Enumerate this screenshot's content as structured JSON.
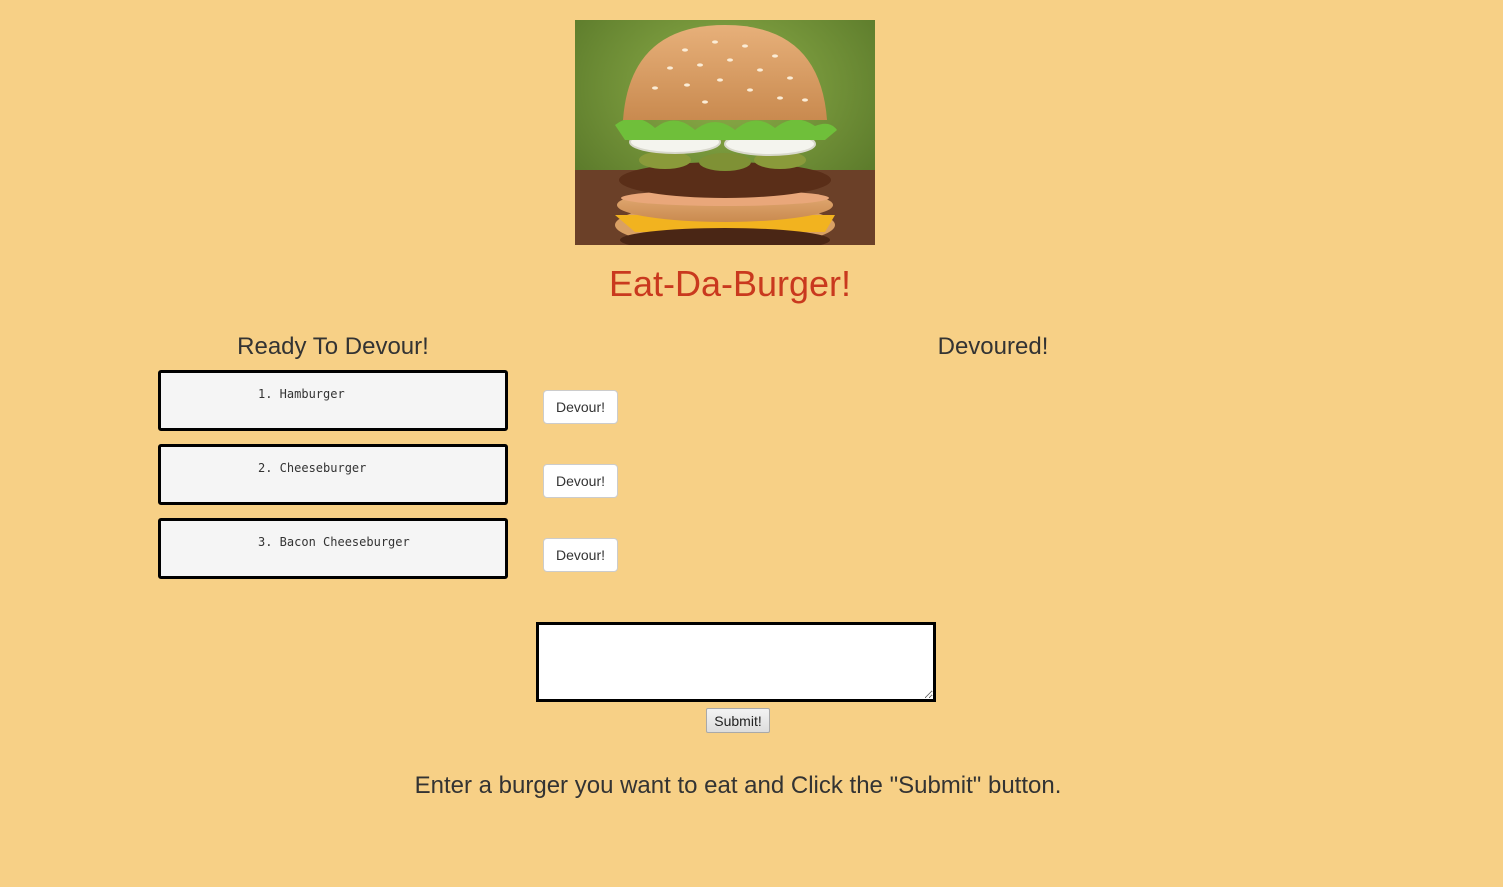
{
  "hero": {
    "image": "burger-photo"
  },
  "title": "Eat-Da-Burger!",
  "ready": {
    "heading": "Ready To Devour!",
    "burgers": [
      {
        "label": "1. Hamburger",
        "button": "Devour!"
      },
      {
        "label": "2. Cheeseburger",
        "button": "Devour!"
      },
      {
        "label": "3. Bacon Cheeseburger",
        "button": "Devour!"
      }
    ]
  },
  "devoured": {
    "heading": "Devoured!"
  },
  "form": {
    "input_value": "",
    "submit_label": "Submit!"
  },
  "instructions": "Enter a burger you want to eat and Click the \"Submit\" button.",
  "colors": {
    "background": "#f7d086",
    "title": "#c9391e",
    "text": "#333333"
  }
}
